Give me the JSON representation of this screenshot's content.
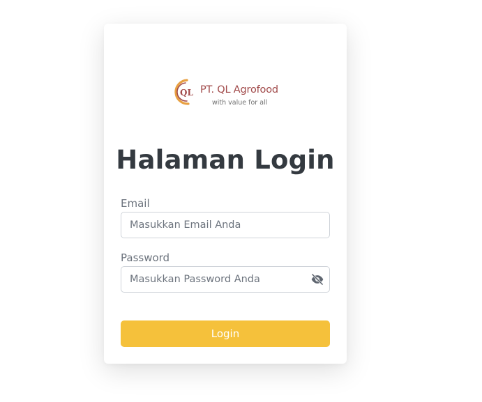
{
  "brand": {
    "monogram": "QL",
    "company": "PT. QL Agrofood",
    "tagline": "with value for all",
    "colors": {
      "primary": "#a14a4a",
      "accent": "#e8a042"
    }
  },
  "page": {
    "title": "Halaman Login"
  },
  "form": {
    "email": {
      "label": "Email",
      "placeholder": "Masukkan Email Anda",
      "value": ""
    },
    "password": {
      "label": "Password",
      "placeholder": "Masukkan Password Anda",
      "value": "",
      "toggle_icon": "eye-slash-icon"
    },
    "submit_label": "Login"
  },
  "colors": {
    "button": "#f5c13b",
    "title": "#343a40",
    "label": "#6c737d",
    "border": "#cfd3d9"
  }
}
